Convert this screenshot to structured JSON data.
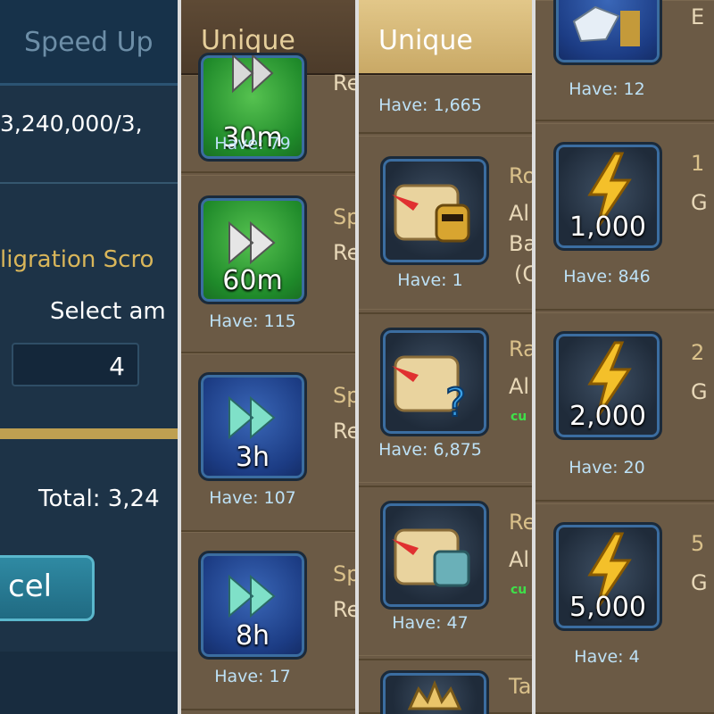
{
  "panel1": {
    "title": "Speed Up",
    "count_text": "3,240,000/3,",
    "item_name": "ligration Scro",
    "select_label": "Select am",
    "amount_value": "4",
    "total_text": "Total: 3,24",
    "cancel_label": "cel"
  },
  "panel2": {
    "header": "Unique",
    "items": [
      {
        "label": "30m",
        "have": "Have: 79",
        "line1": "",
        "line2": "Re"
      },
      {
        "label": "60m",
        "have": "Have: 115",
        "line1": "Sp",
        "line2": "Re"
      },
      {
        "label": "3h",
        "have": "Have: 107",
        "line1": "Sp",
        "line2": "Re"
      },
      {
        "label": "8h",
        "have": "Have: 17",
        "line1": "Sp",
        "line2": "Re"
      }
    ]
  },
  "panel3": {
    "header": "Unique",
    "top_have": "Have: 1,665",
    "items": [
      {
        "have": "Have: 1",
        "line1": "Ro",
        "line2": "Al",
        "line3": "Ba",
        "line4": "(C"
      },
      {
        "have": "Have: 6,875",
        "line1": "Ra",
        "line2": "Al",
        "line3": "cu"
      },
      {
        "have": "Have: 47",
        "line1": "Re",
        "line2": "Al",
        "line3": "cu"
      },
      {
        "line1": "Ta"
      }
    ]
  },
  "panel4": {
    "top_have": "Have: 12",
    "top_text": "E",
    "items": [
      {
        "label": "1,000",
        "have": "Have: 846",
        "line1": "1",
        "line2": "G"
      },
      {
        "label": "2,000",
        "have": "Have: 20",
        "line1": "2",
        "line2": "G"
      },
      {
        "label": "5,000",
        "have": "Have: 4",
        "line1": "5",
        "line2": "G"
      }
    ]
  },
  "colors": {
    "panel_dark_blue": "#1d3347",
    "brown_bg": "#6b5a45",
    "gold_text": "#d9b65a",
    "have_text": "#bde1f6"
  }
}
